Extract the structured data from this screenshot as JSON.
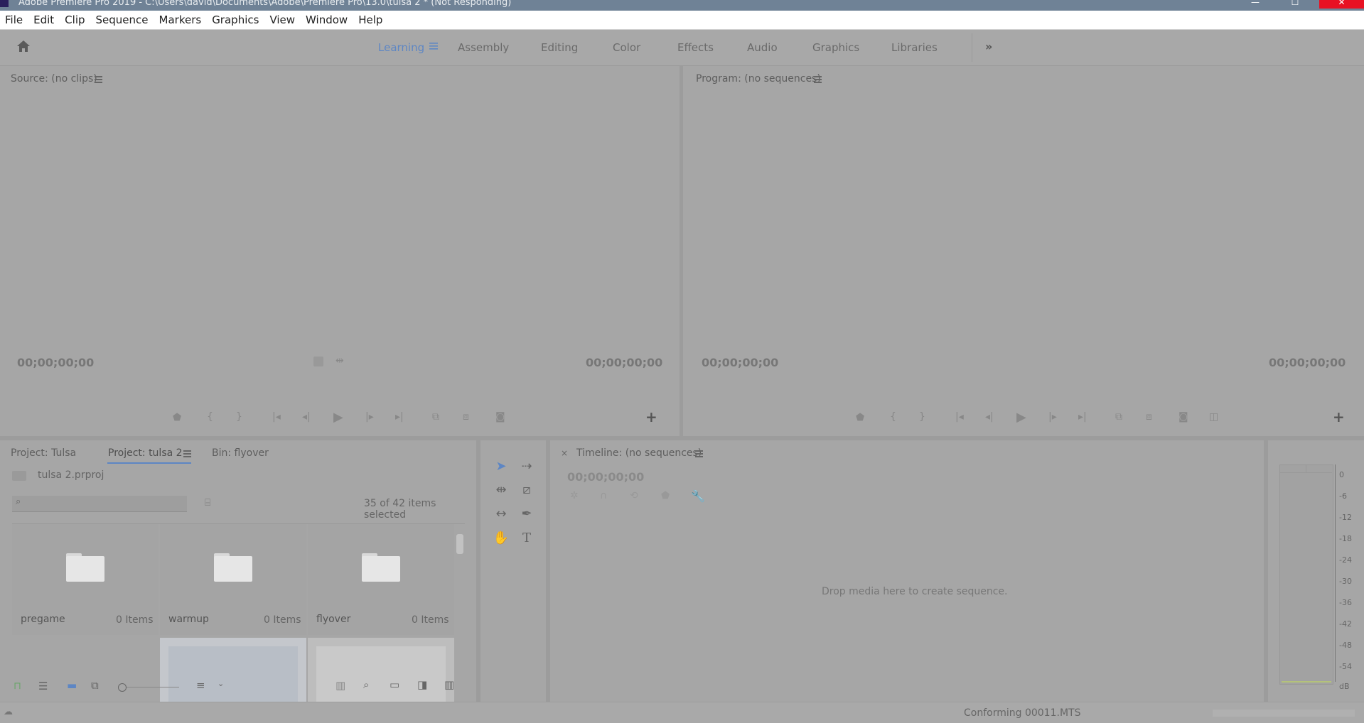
{
  "window": {
    "title": "Adobe Premiere Pro 2019 - C:\\Users\\david\\Documents\\Adobe\\Premiere Pro\\13.0\\tulsa 2 * (Not Responding)"
  },
  "menu": [
    "File",
    "Edit",
    "Clip",
    "Sequence",
    "Markers",
    "Graphics",
    "View",
    "Window",
    "Help"
  ],
  "workspaces": {
    "tabs": [
      "Learning",
      "Assembly",
      "Editing",
      "Color",
      "Effects",
      "Audio",
      "Graphics",
      "Libraries"
    ],
    "active": "Learning"
  },
  "source_monitor": {
    "title": "Source: (no clips)",
    "timecode_left": "00;00;00;00",
    "timecode_right": "00;00;00;00"
  },
  "program_monitor": {
    "title": "Program: (no sequences)",
    "timecode_left": "00;00;00;00",
    "timecode_right": "00;00;00;00"
  },
  "project_panel": {
    "tabs": [
      "Project: Tulsa",
      "Project: tulsa 2",
      "Bin: flyover"
    ],
    "active_tab": "Project: tulsa 2",
    "project_file": "tulsa 2.prproj",
    "search_placeholder": "",
    "selection_status": "35 of 42 items selected",
    "bins": [
      {
        "name": "pregame",
        "count": "0 Items"
      },
      {
        "name": "warmup",
        "count": "0 Items"
      },
      {
        "name": "flyover",
        "count": "0 Items"
      }
    ]
  },
  "timeline": {
    "title": "Timeline: (no sequences)",
    "timecode": "00;00;00;00",
    "empty_message": "Drop media here to create sequence."
  },
  "audio_meter": {
    "ticks": [
      "0",
      "-6",
      "-12",
      "-18",
      "-24",
      "-30",
      "-36",
      "-42",
      "-48",
      "-54",
      "dB"
    ]
  },
  "status_bar": {
    "message": "Conforming 00011.MTS"
  },
  "colors": {
    "accent": "#5d86c4",
    "titlebar": "#6f8296",
    "close_button": "#e81123",
    "panel_bg": "#a6a6a6"
  }
}
